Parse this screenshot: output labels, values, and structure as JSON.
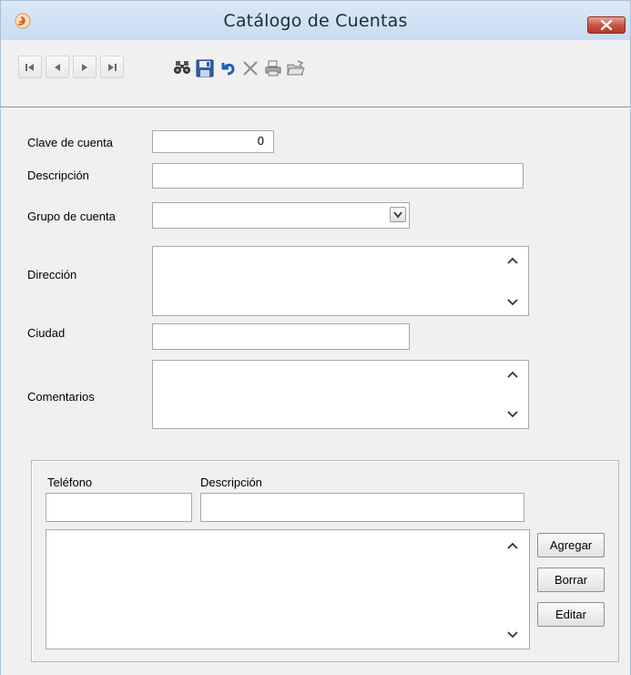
{
  "window": {
    "title": "Catálogo de Cuentas",
    "app_icon": "app-swirl-icon",
    "close_icon": "close-icon"
  },
  "toolbar": {
    "nav_buttons": [
      "first-record-icon",
      "previous-record-icon",
      "next-record-icon",
      "last-record-icon"
    ],
    "action_buttons": [
      "binoculars-search-icon",
      "floppy-save-icon",
      "undo-arrow-icon",
      "delete-x-icon",
      "printer-icon",
      "open-folder-icon"
    ]
  },
  "form": {
    "clave_label": "Clave de cuenta",
    "clave_value": "0",
    "descripcion_label": "Descripción",
    "descripcion_value": "",
    "grupo_label": "Grupo de cuenta",
    "grupo_value": "",
    "direccion_label": "Dirección",
    "direccion_value": "",
    "ciudad_label": "Ciudad",
    "ciudad_value": "",
    "comentarios_label": "Comentarios",
    "comentarios_value": ""
  },
  "phones": {
    "telefono_label": "Teléfono",
    "telefono_value": "",
    "descripcion_label": "Descripción",
    "descripcion_value": "",
    "list_items": [],
    "add_button": "Agregar",
    "delete_button": "Borrar",
    "edit_button": "Editar"
  },
  "colors": {
    "titlebar": "#c9dcf1",
    "close": "#c75040",
    "window_bg": "#f0f0f0"
  }
}
